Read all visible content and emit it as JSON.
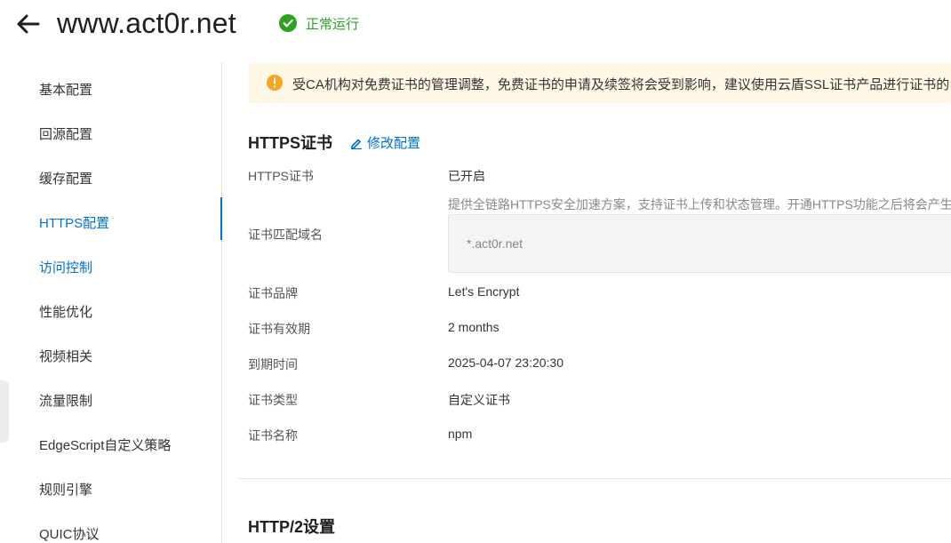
{
  "header": {
    "title": "www.act0r.net",
    "status": "正常运行",
    "status_color": "#2ea121"
  },
  "sidebar": {
    "items": [
      {
        "label": "基本配置"
      },
      {
        "label": "回源配置"
      },
      {
        "label": "缓存配置"
      },
      {
        "label": "HTTPS配置",
        "active": true
      },
      {
        "label": "访问控制"
      },
      {
        "label": "性能优化"
      },
      {
        "label": "视频相关"
      },
      {
        "label": "流量限制"
      },
      {
        "label": "EdgeScript自定义策略"
      },
      {
        "label": "规则引擎"
      },
      {
        "label": "QUIC协议"
      }
    ]
  },
  "notice": {
    "text": "受CA机构对免费证书的管理调整，免费证书的申请及续签将会受到影响，建议使用云盾SSL证书产品进行证书的申请"
  },
  "https_section": {
    "title": "HTTPS证书",
    "edit_label": "修改配置",
    "fields": {
      "https_cert_label": "HTTPS证书",
      "https_cert_value": "已开启",
      "description": "提供全链路HTTPS安全加速方案，支持证书上传和状态管理。开通HTTPS功能之后将会产生",
      "domain_label": "证书匹配域名",
      "domain_value": "*.act0r.net",
      "brand_label": "证书品牌",
      "brand_value": "Let's Encrypt",
      "validity_label": "证书有效期",
      "validity_value": "2 months",
      "expiry_label": "到期时间",
      "expiry_value": "2025-04-07 23:20:30",
      "type_label": "证书类型",
      "type_value": "自定义证书",
      "name_label": "证书名称",
      "name_value": "npm"
    }
  },
  "http2_section": {
    "title": "HTTP/2设置"
  },
  "colors": {
    "accent": "#0070cc",
    "notice_bg": "#fff8e6",
    "notice_icon": "#f5a623"
  }
}
